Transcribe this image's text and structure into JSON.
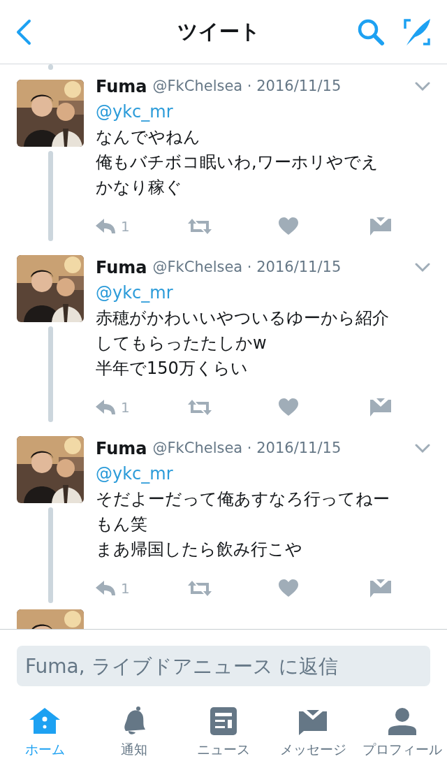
{
  "header": {
    "title": "ツイート"
  },
  "tweets": [
    {
      "name": "Fuma",
      "meta": "@FkChelsea · 2016/11/15",
      "mention": "@ykc_mr",
      "lines": [
        "なんでやねん",
        "俺もバチボコ眠いわ,ワーホリやでえ",
        "かなり稼ぐ"
      ],
      "reply_count": "1"
    },
    {
      "name": "Fuma",
      "meta": "@FkChelsea · 2016/11/15",
      "mention": "@ykc_mr",
      "lines": [
        "赤穂がかわいいやついるゆーから紹介",
        "してもらったたしかw",
        "半年で150万くらい"
      ],
      "reply_count": "1"
    },
    {
      "name": "Fuma",
      "meta": "@FkChelsea · 2016/11/15",
      "mention": "@ykc_mr",
      "lines": [
        "そだよーだって俺あすなろ行ってねー",
        "もん笑",
        "まあ帰国したら飲み行こや"
      ],
      "reply_count": "1"
    }
  ],
  "reply": {
    "placeholder": "Fuma, ライブドアニュース に返信"
  },
  "tabs": [
    {
      "kind": "home",
      "label": "ホーム",
      "selected": true
    },
    {
      "kind": "bell",
      "label": "通知",
      "selected": false
    },
    {
      "kind": "news",
      "label": "ニュース",
      "selected": false
    },
    {
      "kind": "mail",
      "label": "メッセージ",
      "selected": false
    },
    {
      "kind": "person",
      "label": "プロフィール",
      "selected": false
    }
  ]
}
